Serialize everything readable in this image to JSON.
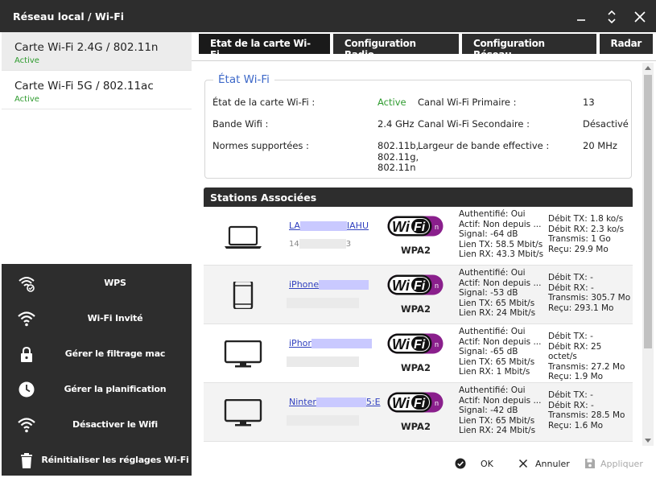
{
  "window": {
    "title": "Réseau local / Wi-Fi"
  },
  "cards": [
    {
      "name": "Carte Wi-Fi 2.4G / 802.11n",
      "status": "Active"
    },
    {
      "name": "Carte Wi-Fi 5G / 802.11ac",
      "status": "Active"
    }
  ],
  "actions": [
    {
      "label": "WPS",
      "icon": "wps-icon"
    },
    {
      "label": "Wi-Fi Invité",
      "icon": "wifi-guest-icon"
    },
    {
      "label": "Gérer le filtrage mac",
      "icon": "lock-icon"
    },
    {
      "label": "Gérer la planification",
      "icon": "clock-icon"
    },
    {
      "label": "Désactiver le Wifi",
      "icon": "wifi-icon"
    },
    {
      "label": "Réinitialiser les réglages Wi-Fi",
      "icon": "trash-icon"
    }
  ],
  "tabs": [
    {
      "label": "Etat de la carte Wi-Fi"
    },
    {
      "label": "Configuration Radio"
    },
    {
      "label": "Configuration Réseau"
    },
    {
      "label": "Radar"
    }
  ],
  "etat": {
    "legend": "État Wi-Fi",
    "etat_carte_label": "État de la carte Wi-Fi :",
    "etat_carte_value": "Active",
    "canal_primaire_label": "Canal Wi-Fi Primaire :",
    "canal_primaire_value": "13",
    "bande_label": "Bande Wifi :",
    "bande_value": "2.4 GHz",
    "canal_secondaire_label": "Canal Wi-Fi Secondaire :",
    "canal_secondaire_value": "Désactivé",
    "normes_label": "Normes supportées :",
    "normes_values": [
      "802.11b,",
      "802.11g,",
      "802.11n"
    ],
    "largeur_label": "Largeur de bande effective :",
    "largeur_value": "20 MHz"
  },
  "stations": {
    "title": "Stations Associées",
    "rows": [
      {
        "device": "laptop-icon",
        "name_start": "LA",
        "name_end": "IAHU",
        "ip_start": "14",
        "ip_end": "3",
        "security": "WPA2",
        "auth": "Authentifié: Oui",
        "actif": "Actif: Non depuis ...",
        "signal": "Signal: -64 dB",
        "lien_tx": "Lien TX: 58.5 Mbit/s",
        "lien_rx": "Lien RX: 43.3 Mbit/s",
        "debit_tx": "Débit TX: 1.8 ko/s",
        "debit_rx": "Débit RX: 2.3 ko/s",
        "transmis": "Transmis: 1 Go",
        "recu": "Reçu: 29.9 Mo"
      },
      {
        "device": "phone-icon",
        "name_start": "iPhone",
        "name_end": "",
        "ip_start": "",
        "ip_end": "",
        "security": "WPA2",
        "auth": "Authentifié: Oui",
        "actif": "Actif: Non depuis ...",
        "signal": "Signal: -53 dB",
        "lien_tx": "Lien TX: 65 Mbit/s",
        "lien_rx": "Lien RX: 24 Mbit/s",
        "debit_tx": "Débit TX: -",
        "debit_rx": "Débit RX: -",
        "transmis": "Transmis: 305.7 Mo",
        "recu": "Reçu: 293.1 Mo"
      },
      {
        "device": "monitor-icon",
        "name_start": "iPhor",
        "name_end": "",
        "ip_start": "",
        "ip_end": "",
        "security": "WPA2",
        "auth": "Authentifié: Oui",
        "actif": "Actif: Non depuis ...",
        "signal": "Signal: -65 dB",
        "lien_tx": "Lien TX: 65 Mbit/s",
        "lien_rx": "Lien RX: 1 Mbit/s",
        "debit_tx": "Débit TX: -",
        "debit_rx": "Débit RX: 25 octet/s",
        "transmis": "Transmis: 27.2 Mo",
        "recu": "Reçu: 1.9 Mo"
      },
      {
        "device": "monitor-icon",
        "name_start": "Ninter",
        "name_end": "5:E",
        "ip_start": "",
        "ip_end": "",
        "security": "WPA2",
        "auth": "Authentifié: Oui",
        "actif": "Actif: Non depuis ...",
        "signal": "Signal: -42 dB",
        "lien_tx": "Lien TX: 65 Mbit/s",
        "lien_rx": "Lien RX: 24 Mbit/s",
        "debit_tx": "Débit TX: -",
        "debit_rx": "Débit RX: -",
        "transmis": "Transmis: 28.5 Mo",
        "recu": "Reçu: 1.6 Mo"
      }
    ]
  },
  "footer": {
    "ok": "OK",
    "cancel": "Annuler",
    "apply": "Appliquer"
  },
  "colors": {
    "dark": "#2d2d2d",
    "active_green": "#2e9b2e",
    "link_blue": "#2f3fbf",
    "legend_blue": "#3d68c8",
    "wifi_purple": "#8a1f8c"
  }
}
